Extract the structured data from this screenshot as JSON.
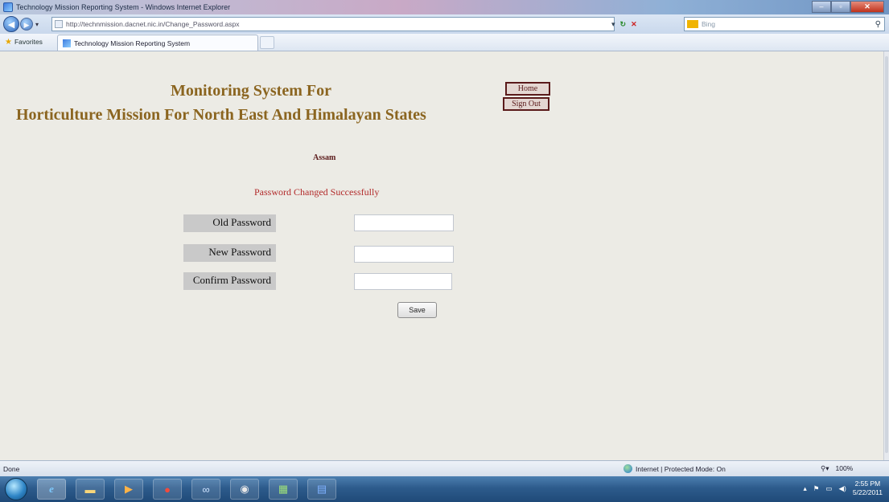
{
  "window": {
    "title": "Technology Mission Reporting System - Windows Internet Explorer"
  },
  "browser": {
    "url": "http://technmission.dacnet.nic.in/Change_Password.aspx",
    "search_placeholder": "Bing",
    "favorites_label": "Favorites",
    "tab_title": "Technology Mission Reporting System",
    "status_text": "Done",
    "zone_text": "Internet | Protected Mode: On",
    "zoom_text": "100%"
  },
  "page": {
    "heading_line1": "Monitoring System For",
    "heading_line2": "Horticulture Mission For North East And Himalayan States",
    "nav": {
      "home": "Home",
      "sign_out": "Sign Out"
    },
    "state": "Assam",
    "message": "Password Changed Successfully",
    "form": {
      "old_password_label": "Old Password",
      "new_password_label": "New Password",
      "confirm_password_label": "Confirm Password",
      "old_password_value": "",
      "new_password_value": "",
      "confirm_password_value": "",
      "save_label": "Save"
    }
  },
  "taskbar": {
    "time": "2:55 PM",
    "date": "5/22/2011"
  }
}
